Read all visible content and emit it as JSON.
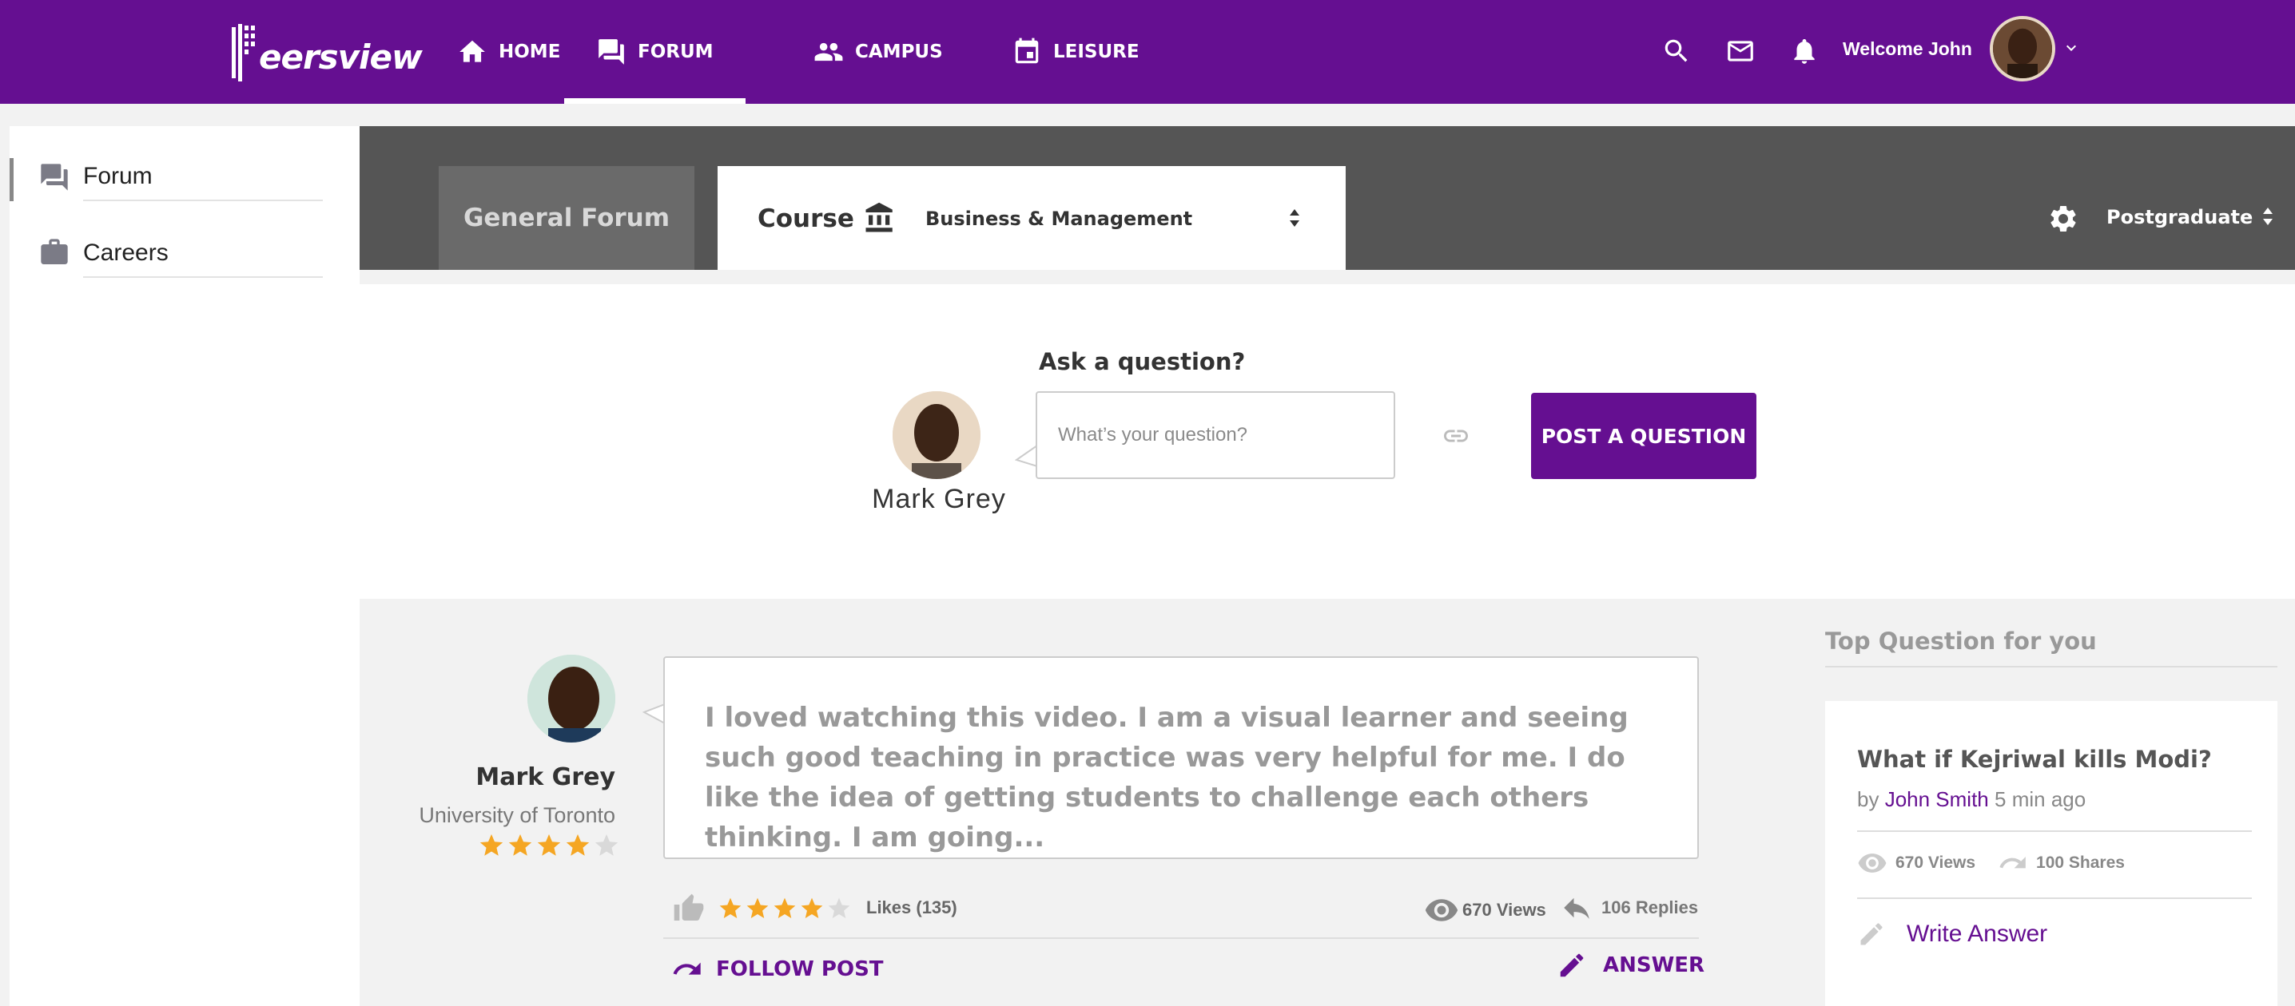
{
  "brand": {
    "name": "Peersview"
  },
  "nav": {
    "items": [
      {
        "label": "HOME",
        "icon": "home-icon"
      },
      {
        "label": "FORUM",
        "icon": "forum-icon",
        "active": true
      },
      {
        "label": "CAMPUS",
        "icon": "people-icon"
      },
      {
        "label": "LEISURE",
        "icon": "calendar-icon"
      }
    ],
    "welcome": "Welcome John"
  },
  "sidebar": {
    "items": [
      {
        "label": "Forum",
        "icon": "forum-icon",
        "active": true
      },
      {
        "label": "Careers",
        "icon": "briefcase-icon"
      }
    ]
  },
  "coursebar": {
    "general_tab": "General Forum",
    "course_label": "Course",
    "course_value": "Business & Management",
    "level": "Postgraduate"
  },
  "ask": {
    "heading": "Ask a question?",
    "placeholder": "What’s your question?",
    "user_name": "Mark Grey",
    "button": "POST A QUESTION"
  },
  "post": {
    "author": "Mark Grey",
    "university": "University of Toronto",
    "author_rating": 4,
    "text": "I loved watching this video. I am a visual learner and seeing such good teaching in practice was very helpful for me. I do like the idea of getting students to challenge each others thinking. I am going...",
    "post_rating": 4,
    "likes": "Likes (135)",
    "views": "670 Views",
    "replies": "106 Replies",
    "follow": "FOLLOW POST",
    "answer": "ANSWER"
  },
  "top_question": {
    "heading": "Top Question for you",
    "title": "What if Kejriwal kills Modi?",
    "by": "by",
    "author": "John Smith",
    "time": "5 min ago",
    "views": "670 Views",
    "shares": "100 Shares",
    "write": "Write Answer"
  },
  "colors": {
    "brand": "#650f91",
    "star": "#f5a623",
    "star_empty": "#d9d9d9"
  }
}
